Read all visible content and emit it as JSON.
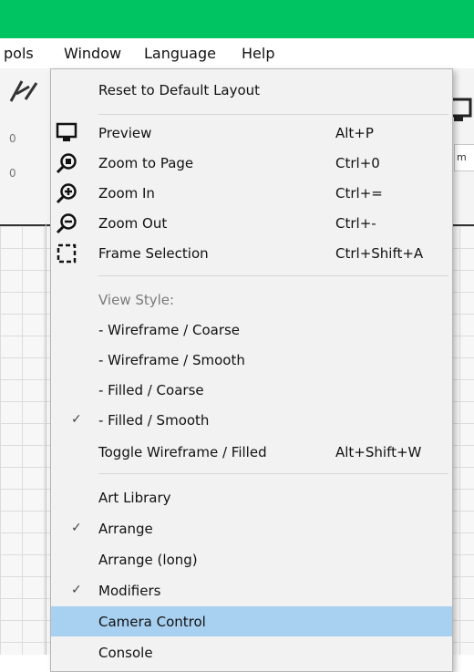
{
  "menubar": {
    "items": [
      "pols",
      "Window",
      "Language",
      "Help"
    ]
  },
  "background": {
    "numbers": [
      "0",
      "0"
    ],
    "field_text": "m"
  },
  "menu": {
    "reset": "Reset to Default Layout",
    "preview": {
      "label": "Preview",
      "shortcut": "Alt+P",
      "icon": "monitor-icon"
    },
    "zoom_page": {
      "label": "Zoom to Page",
      "shortcut": "Ctrl+0",
      "icon": "zoom-page-icon"
    },
    "zoom_in": {
      "label": "Zoom In",
      "shortcut": "Ctrl+=",
      "icon": "zoom-in-icon"
    },
    "zoom_out": {
      "label": "Zoom Out",
      "shortcut": "Ctrl+-",
      "icon": "zoom-out-icon"
    },
    "frame_selection": {
      "label": "Frame Selection",
      "shortcut": "Ctrl+Shift+A",
      "icon": "frame-selection-icon"
    },
    "view_style_header": "View Style:",
    "wire_coarse": "- Wireframe / Coarse",
    "wire_smooth": "- Wireframe / Smooth",
    "filled_coarse": "- Filled / Coarse",
    "filled_smooth": "- Filled / Smooth",
    "toggle": {
      "label": "Toggle Wireframe / Filled",
      "shortcut": "Alt+Shift+W"
    },
    "art_library": "Art Library",
    "arrange": "Arrange",
    "arrange_long": "Arrange (long)",
    "modifiers": "Modifiers",
    "camera_control": "Camera Control",
    "console": "Console",
    "checked": [
      "filled_smooth",
      "arrange",
      "modifiers"
    ],
    "highlighted": "camera_control"
  },
  "check_mark": "✓",
  "colors": {
    "title_bar": "#00c462",
    "menu_bg": "#f2f2f2",
    "highlight": "#a8d0f0",
    "header_text": "#7a7a7a"
  }
}
